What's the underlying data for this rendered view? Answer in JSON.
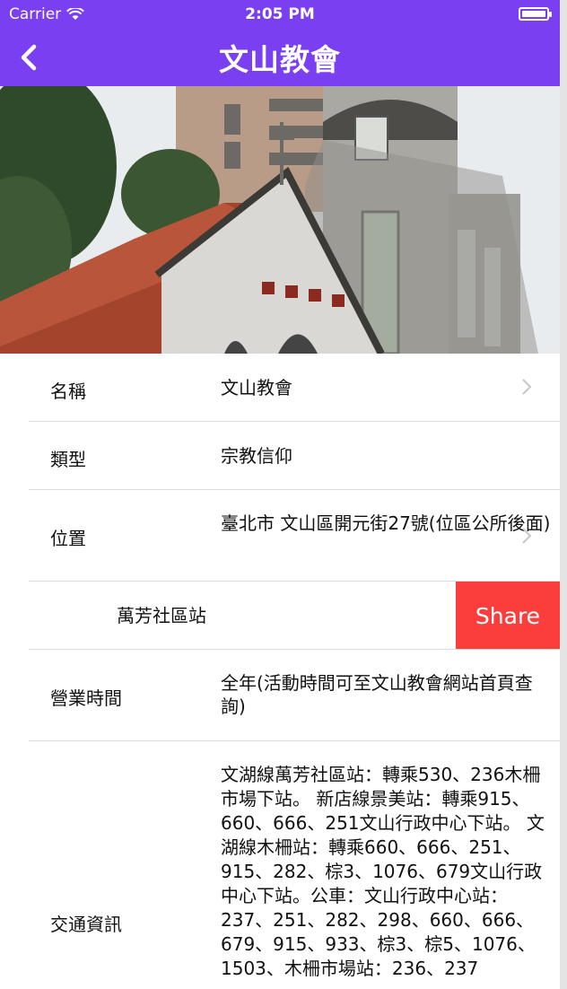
{
  "status_bar": {
    "carrier": "Carrier",
    "time": "2:05 PM"
  },
  "nav": {
    "title": "文山教會",
    "back_icon": "chevron-left-icon"
  },
  "hero": {
    "alt_icon": "church-photo"
  },
  "rows": {
    "name": {
      "label": "名稱",
      "value": "文山教會"
    },
    "type": {
      "label": "類型",
      "value": "宗教信仰"
    },
    "location": {
      "label": "位置",
      "value": "臺北市  文山區開元街27號(位區公所後面)"
    },
    "station": {
      "value": "萬芳社區站",
      "share_label": "Share"
    },
    "hours": {
      "label": "營業時間",
      "value": "全年(活動時間可至文山教會網站首頁查詢)"
    },
    "transport": {
      "label": "交通資訊",
      "value": "文湖線萬芳社區站：轉乘530、236木柵市場下站。 新店線景美站：轉乘915、660、666、251文山行政中心下站。 文湖線木柵站：轉乘660、666、251、915、282、棕3、1076、679文山行政中心下站。公車：文山行政中心站：237、251、282、298、660、666、679、915、933、棕3、棕5、1076、1503、木柵市場站：236、237"
    }
  },
  "colors": {
    "nav_bg": "#7a3ff0",
    "share_bg": "#fb3e3c"
  }
}
